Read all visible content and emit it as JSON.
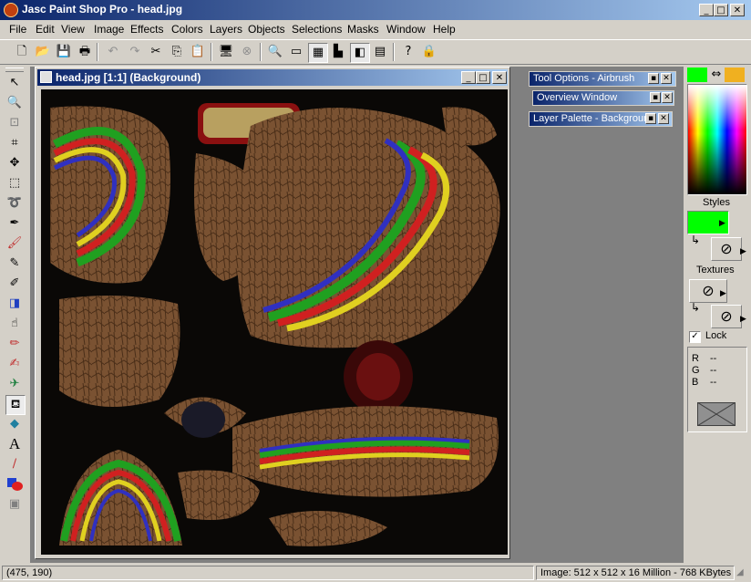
{
  "window": {
    "title": "Jasc Paint Shop Pro - head.jpg",
    "minimize": "_",
    "maximize": "□",
    "close": "✕"
  },
  "menu": [
    "File",
    "Edit",
    "View",
    "Image",
    "Effects",
    "Colors",
    "Layers",
    "Objects",
    "Selections",
    "Masks",
    "Window",
    "Help"
  ],
  "toolbar_icons": [
    "new-icon",
    "open-icon",
    "save-icon",
    "print-icon",
    "undo-icon",
    "redo-icon",
    "cut-icon",
    "copy-icon",
    "paste-icon",
    "browse-icon",
    "cancel-icon",
    "zoom-icon",
    "histogram-icon",
    "palette-icon",
    "layers-icon",
    "overview-icon",
    "toolbar-icon",
    "help-icon",
    "lock-icon"
  ],
  "tools": [
    "arrow-tool-icon",
    "zoom-tool-icon",
    "deformation-tool-icon",
    "crop-tool-icon",
    "mover-tool-icon",
    "selection-tool-icon",
    "freehand-tool-icon",
    "dropper-tool-icon",
    "paintbrush-tool-icon",
    "clone-brush-icon",
    "color-replacer-icon",
    "retouch-tool-icon",
    "scratch-remover-icon",
    "eraser-tool-icon",
    "picture-tube-icon",
    "airbrush-tool-icon",
    "flood-fill-icon",
    "text-tool-icon",
    "draw-tool-icon",
    "preset-shapes-icon",
    "object-selector-icon"
  ],
  "document": {
    "title": "head.jpg [1:1] (Background)",
    "minimize": "_",
    "maximize": "□",
    "close": "✕"
  },
  "palettes": {
    "tool_options": "Tool Options - Airbrush",
    "overview": "Overview Window",
    "layer": "Layer Palette - Background",
    "close": "✕",
    "pin": "▪"
  },
  "colors_panel": {
    "foreground": "#00ff00",
    "background": "#f0b020",
    "styles_label": "Styles",
    "textures_label": "Textures",
    "lock_label": "Lock",
    "lock_checked": true,
    "rgb": [
      {
        "k": "R",
        "v": "--"
      },
      {
        "k": "G",
        "v": "--"
      },
      {
        "k": "B",
        "v": "--"
      }
    ]
  },
  "status": {
    "coords": "(475, 190)",
    "image_info": "Image:  512 x 512 x 16 Million - 768 KBytes"
  }
}
